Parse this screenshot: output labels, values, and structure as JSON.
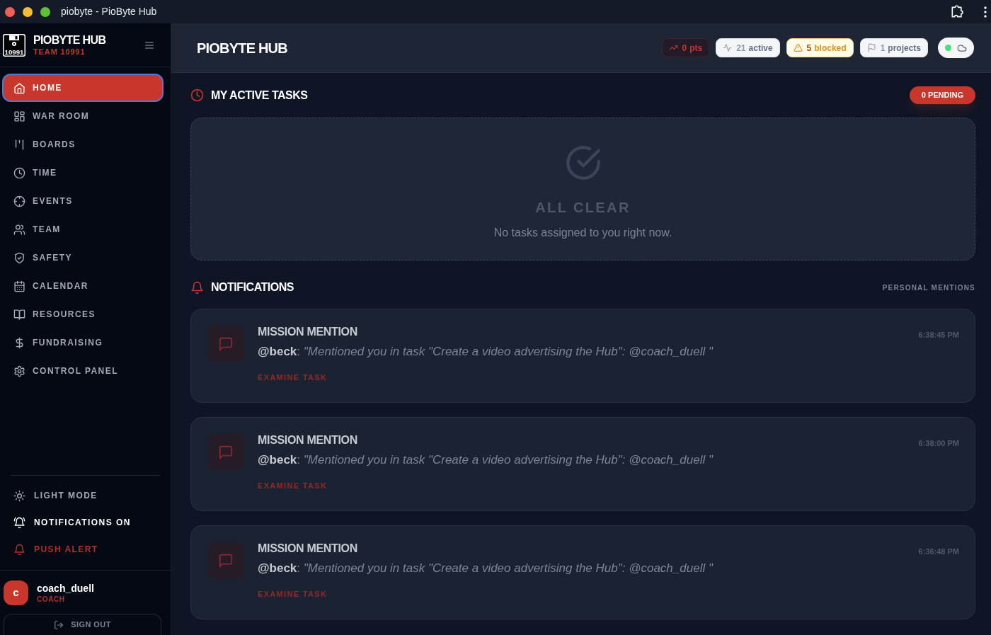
{
  "window": {
    "title": "piobyte - PioByte Hub"
  },
  "sidebar": {
    "brand": {
      "logo_label": "10991",
      "name": "PIOBYTE HUB",
      "team": "TEAM 10991"
    },
    "nav": [
      {
        "label": "HOME",
        "selected": true
      },
      {
        "label": "WAR ROOM",
        "selected": false
      },
      {
        "label": "BOARDS",
        "selected": false
      },
      {
        "label": "TIME",
        "selected": false
      },
      {
        "label": "EVENTS",
        "selected": false
      },
      {
        "label": "TEAM",
        "selected": false
      },
      {
        "label": "SAFETY",
        "selected": false
      },
      {
        "label": "CALENDAR",
        "selected": false
      },
      {
        "label": "RESOURCES",
        "selected": false
      },
      {
        "label": "FUNDRAISING",
        "selected": false
      },
      {
        "label": "CONTROL PANEL",
        "selected": false
      }
    ],
    "settings": [
      {
        "kind": "default",
        "label": "LIGHT MODE"
      },
      {
        "kind": "highlighted",
        "label": "NOTIFICATIONS ON"
      },
      {
        "kind": "danger",
        "label": "PUSH ALERT"
      }
    ],
    "user": {
      "initial": "c",
      "name": "coach_duell",
      "role": "COACH"
    },
    "sign_out": "SIGN OUT"
  },
  "header": {
    "title": "PIOBYTE HUB",
    "stats": [
      {
        "kind": "points",
        "count": "0",
        "label": "pts"
      },
      {
        "kind": "active",
        "count": "21",
        "label": "active"
      },
      {
        "kind": "blocked",
        "count": "5",
        "label": "blocked"
      },
      {
        "kind": "projects",
        "count": "1",
        "label": "projects"
      }
    ],
    "status": {
      "online": true
    }
  },
  "tasks": {
    "title": "MY ACTIVE TASKS",
    "pending": "0 PENDING",
    "empty": {
      "title": "ALL CLEAR",
      "message": "No tasks assigned to you right now."
    }
  },
  "notifications": {
    "title": "NOTIFICATIONS",
    "filter": "PERSONAL MENTIONS",
    "items": [
      {
        "title": "MISSION MENTION",
        "text": "**@beck**: *\"Mentioned you in task \"Create a video advertising the Hub\": @coach_duell \"*",
        "time": "6:38:45 PM",
        "action": "EXAMINE TASK"
      },
      {
        "title": "MISSION MENTION",
        "text": "**@beck**: *\"Mentioned you in task \"Create a video advertising the Hub\": @coach_duell \"*",
        "time": "6:38:00 PM",
        "action": "EXAMINE TASK"
      },
      {
        "title": "MISSION MENTION",
        "text": "**@beck**: *\"Mentioned you in task \"Create a video advertising the Hub\": @coach_duell \"*",
        "time": "6:36:48 PM",
        "action": "EXAMINE TASK"
      }
    ]
  }
}
